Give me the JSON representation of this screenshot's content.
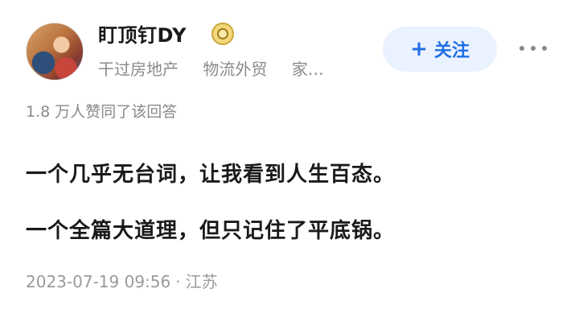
{
  "author": {
    "name": "盯顶钉DY",
    "badge_icon": "gold-medal-icon",
    "tags": [
      "干过房地产",
      "物流外贸",
      "家…"
    ]
  },
  "actions": {
    "follow_label": "关注",
    "follow_icon": "plus-icon",
    "more_icon": "more-dots-icon",
    "accent_color": "#1f6fe5"
  },
  "answer": {
    "likes_text": "1.8 万人赞同了该回答",
    "lines": [
      "一个几乎无台词，让我看到人生百态。",
      "一个全篇大道理，但只记住了平底锅。"
    ],
    "date": "2023-07-19 09:56",
    "separator": "·",
    "location": "江苏"
  }
}
